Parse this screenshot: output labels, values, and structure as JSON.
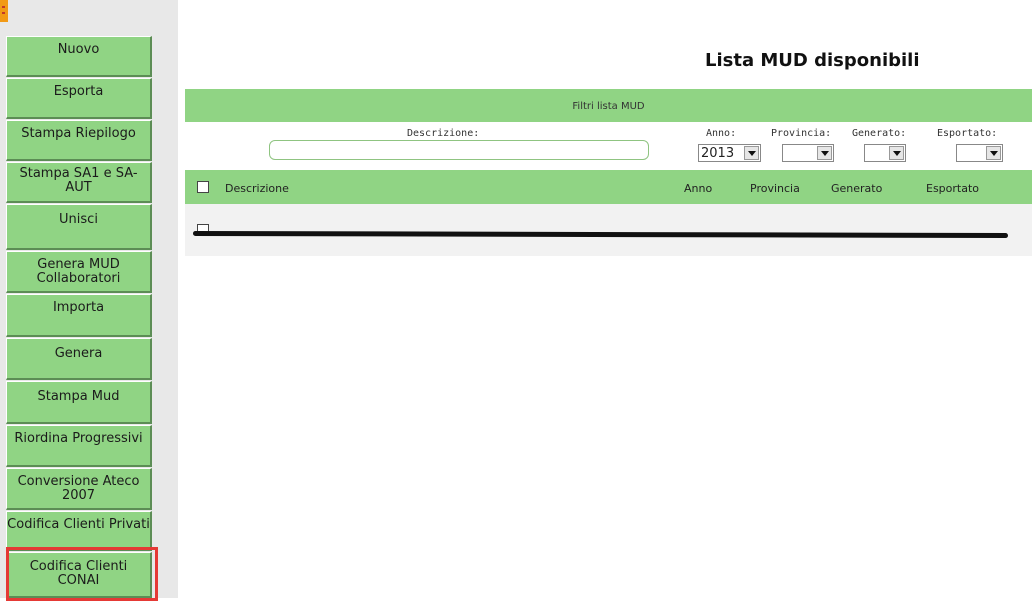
{
  "sidebar": {
    "buttons": [
      {
        "label": "Nuovo"
      },
      {
        "label": "Esporta"
      },
      {
        "label": "Stampa Riepilogo"
      },
      {
        "label": "Stampa SA1 e SA-AUT"
      },
      {
        "label": "Unisci"
      },
      {
        "label": "Genera MUD Collaboratori"
      },
      {
        "label": "Importa"
      },
      {
        "label": "Genera"
      },
      {
        "label": "Stampa Mud"
      },
      {
        "label": "Riordina Progressivi"
      },
      {
        "label": "Conversione Ateco 2007"
      },
      {
        "label": "Codifica Clienti Privati"
      },
      {
        "label": "Codifica Clienti CONAI"
      }
    ],
    "highlighted_button": "Codifica Clienti CONAI"
  },
  "main": {
    "title": "Lista MUD disponibili",
    "filters": {
      "title": "Filtri lista MUD",
      "descrizione_label": "Descrizione:",
      "descrizione_value": "",
      "anno_label": "Anno:",
      "anno_value": "2013",
      "provincia_label": "Provincia:",
      "provincia_value": "",
      "generato_label": "Generato:",
      "generato_value": "",
      "esportato_label": "Esportato:",
      "esportato_value": ""
    },
    "columns": {
      "descrizione": "Descrizione",
      "anno": "Anno",
      "provincia": "Provincia",
      "generato": "Generato",
      "esportato": "Esportato"
    }
  },
  "colors": {
    "green": "#90d484",
    "highlight": "#e53935",
    "logo": "#f29a16"
  }
}
